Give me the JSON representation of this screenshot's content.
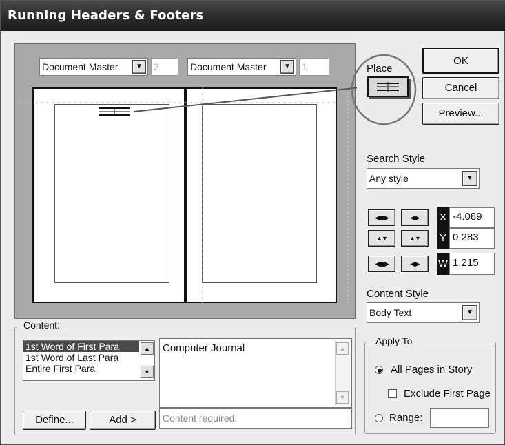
{
  "window": {
    "title": "Running Headers & Footers"
  },
  "preview": {
    "left_master": "Document Master",
    "left_page_number": "2",
    "right_master": "Document Master",
    "right_page_number": "1"
  },
  "buttons": {
    "ok": "OK",
    "cancel": "Cancel",
    "preview": "Preview..."
  },
  "place": {
    "label": "Place",
    "icon": "place-header-icon"
  },
  "search_style": {
    "label": "Search Style",
    "value": "Any style"
  },
  "position": {
    "x_label": "X",
    "x_value": "-4.089",
    "y_label": "Y",
    "y_value": "0.283",
    "w_label": "W",
    "w_value": "1.215"
  },
  "content_style": {
    "label": "Content Style",
    "value": "Body Text"
  },
  "content": {
    "group_label": "Content:",
    "options": [
      "1st Word of First Para",
      "1st Word of Last Para",
      "Entire First Para"
    ],
    "selected_index": 0,
    "text": "Computer Journal",
    "status": "Content required.",
    "define_button": "Define...",
    "add_button": "Add >"
  },
  "apply_to": {
    "group_label": "Apply To",
    "all_pages": "All Pages in Story",
    "exclude_first": "Exclude First Page",
    "range": "Range:",
    "range_value": ""
  },
  "colors": {
    "title_bar": "#2a2a2a",
    "dialog_bg": "#ececec",
    "preview_bg": "#a9a9a9",
    "selection": "#4a4a4a"
  }
}
